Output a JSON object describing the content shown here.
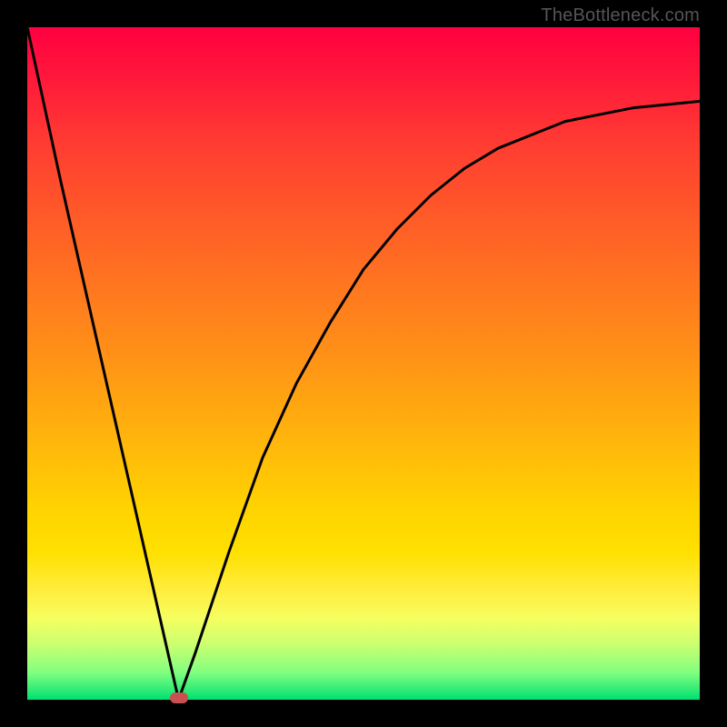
{
  "watermark": "TheBottleneck.com",
  "colors": {
    "frame": "#000000",
    "curve": "#000000",
    "marker": "#c95050",
    "gradient_stops": [
      "#ff0040",
      "#ff7a1e",
      "#ffd400",
      "#00e070"
    ]
  },
  "chart_data": {
    "type": "line",
    "title": "",
    "xlabel": "",
    "ylabel": "",
    "xlim": [
      0,
      1
    ],
    "ylim": [
      0,
      1
    ],
    "minimum": {
      "x": 0.225,
      "y": 0.0
    },
    "marker": {
      "x": 0.225,
      "y": 0.0
    },
    "series": [
      {
        "name": "curve",
        "x": [
          0.0,
          0.05,
          0.1,
          0.15,
          0.2,
          0.225,
          0.25,
          0.3,
          0.35,
          0.4,
          0.45,
          0.5,
          0.55,
          0.6,
          0.65,
          0.7,
          0.75,
          0.8,
          0.85,
          0.9,
          0.95,
          1.0
        ],
        "y": [
          1.0,
          0.77,
          0.55,
          0.33,
          0.11,
          0.0,
          0.07,
          0.22,
          0.36,
          0.47,
          0.56,
          0.64,
          0.7,
          0.75,
          0.79,
          0.82,
          0.84,
          0.86,
          0.87,
          0.88,
          0.885,
          0.89
        ]
      }
    ],
    "background_gradient": {
      "direction": "vertical",
      "from": "red",
      "to": "green",
      "meaning": "qualitative severity scale (red high, green low)"
    }
  }
}
